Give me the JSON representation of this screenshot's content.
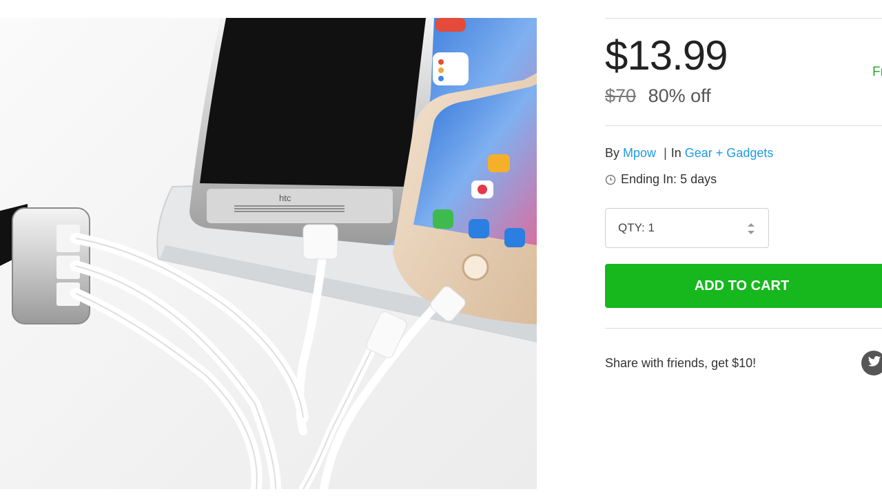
{
  "product": {
    "price": "$13.99",
    "original_price": "$70",
    "discount": "80% off",
    "shipping_partial": "Fr",
    "by_prefix": "By",
    "vendor": "Mpow",
    "separator": "|",
    "in_prefix": "In",
    "category": "Gear + Gadgets",
    "ending": "Ending In: 5 days",
    "image_brand_text": "htc"
  },
  "qty": {
    "label": "QTY: 1"
  },
  "cart": {
    "button_label": "ADD TO CART"
  },
  "share": {
    "text": "Share with friends, get $10!"
  },
  "colors": {
    "price": "#222222",
    "link": "#1e9be3",
    "cart_button": "#16b81e",
    "free_shipping": "#2fa62f",
    "divider": "#dcdcdc"
  },
  "icons": [
    "clock-icon",
    "select-arrows-icon",
    "twitter-icon"
  ]
}
